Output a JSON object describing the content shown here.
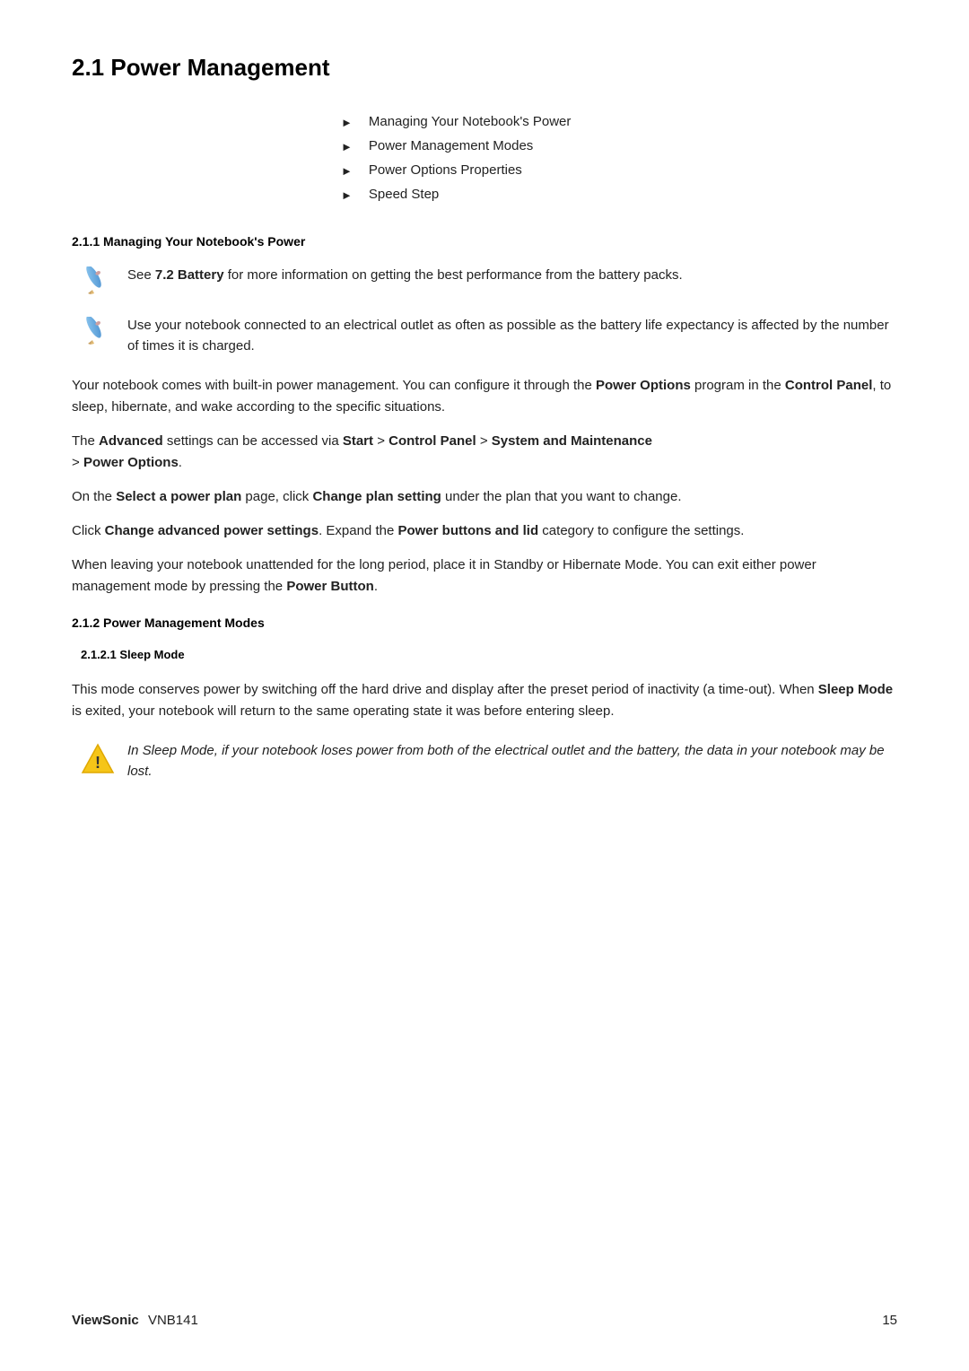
{
  "page": {
    "title": "2.1 Power Management",
    "footer": {
      "brand": "ViewSonic",
      "model": "VNB141",
      "page_number": "15"
    }
  },
  "toc": {
    "items": [
      "Managing Your Notebook's Power",
      "Power Management Modes",
      "Power Options Properties",
      "Speed Step"
    ]
  },
  "section_211": {
    "heading": "2.1.1 Managing Your Notebook's Power",
    "note1": "See 7.2 Battery for more information on getting the best performance from the battery packs.",
    "note1_bold": "7.2 Battery",
    "note2": "Use your notebook connected to an electrical outlet as often as possible as the battery life expectancy is affected by the number of times it is charged.",
    "para1_text": "Your notebook comes with built-in power management. You can configure it through the ",
    "para1_bold1": "Power Options",
    "para1_mid": " program in the ",
    "para1_bold2": "Control Panel",
    "para1_end": ", to sleep, hibernate, and wake according to the specific situations.",
    "para2_text": "The ",
    "para2_bold1": "Advanced",
    "para2_mid1": " settings can be accessed via ",
    "para2_bold2": "Start",
    "para2_gt1": " > ",
    "para2_bold3": "Control Panel",
    "para2_gt2": " > ",
    "para2_bold4": "System and Maintenance",
    "para2_gt3": " > ",
    "para2_bold5": "Power Options",
    "para2_end": ".",
    "para3_text": "On the ",
    "para3_bold1": "Select a power plan",
    "para3_mid": " page, click ",
    "para3_bold2": "Change plan setting",
    "para3_end": " under the plan that you want to change.",
    "para4_text": "Click ",
    "para4_bold1": "Change advanced power settings",
    "para4_mid": ". Expand the ",
    "para4_bold2": "Power buttons and lid",
    "para4_end": " category to configure the settings.",
    "para5_text": "When leaving your notebook unattended for the long period, place it in Standby or Hibernate Mode. You can exit either power management mode by pressing the ",
    "para5_bold": "Power Button",
    "para5_end": "."
  },
  "section_212": {
    "heading": "2.1.2 Power Management Modes"
  },
  "section_2121": {
    "heading": "2.1.2.1 Sleep Mode",
    "para1_text": "This mode conserves power by switching off the hard drive and display after the preset period of inactivity (a time-out). When ",
    "para1_bold": "Sleep Mode",
    "para1_end": " is exited, your notebook will return to the same operating state it was before entering sleep.",
    "warning_text": "In Sleep Mode, if your notebook loses power from both of the electrical outlet and the battery, the data in your notebook may be lost."
  }
}
